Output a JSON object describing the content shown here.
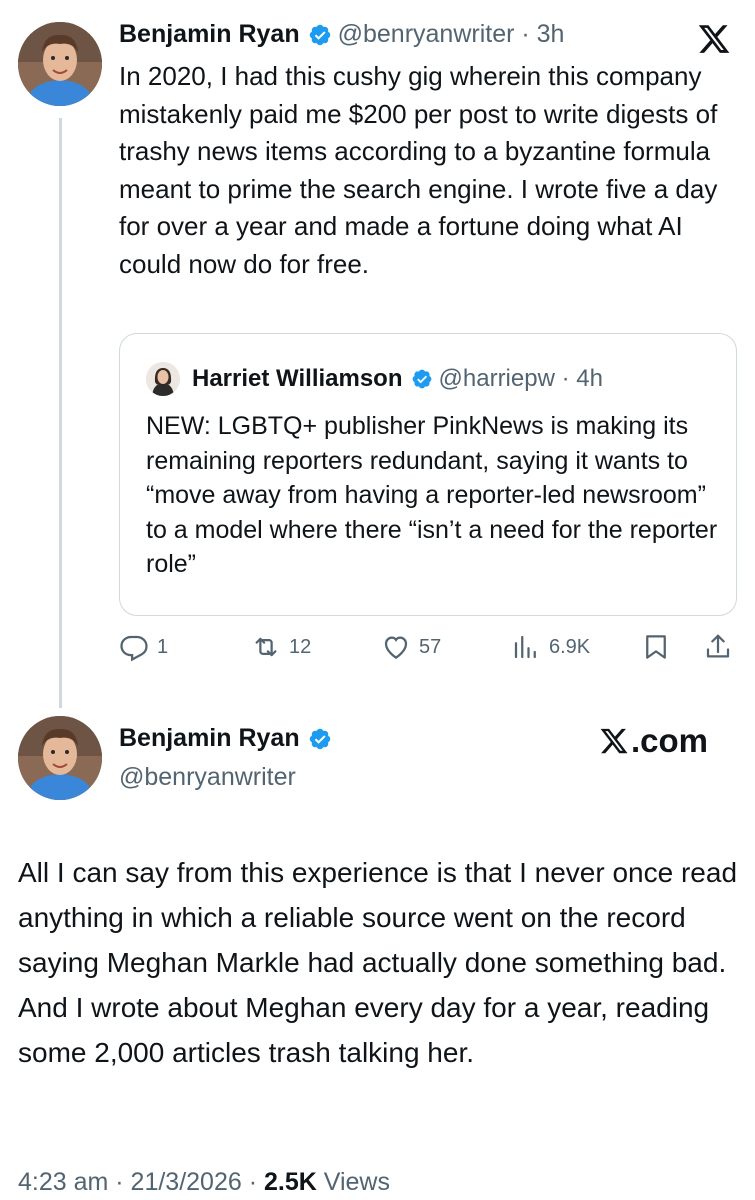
{
  "colors": {
    "text": "#0f1419",
    "muted": "#536471",
    "verified": "#1d9bf0",
    "border": "#cfd9de"
  },
  "tweet1": {
    "author_name": "Benjamin Ryan",
    "handle_time": "@benryanwriter · 3h",
    "text": "In 2020, I had this cushy gig wherein this company mistakenly paid me $200 per post to write digests of trashy news items according to a byzantine formula meant to prime the search engine. I wrote five a day for over a year and made a fortune doing what AI could now do for free.",
    "avatar_icon": "profile-photo",
    "quote": {
      "author_name": "Harriet Williamson",
      "handle_time": "@harriepw · 4h",
      "text": "NEW: LGBTQ+ publisher PinkNews is making its remaining reporters redundant, saying it wants to “move away from having a reporter-led newsroom” to a model where there “isn’t a need for the reporter role”"
    },
    "actions": {
      "replies": "1",
      "reposts": "12",
      "likes": "57",
      "views": "6.9K"
    }
  },
  "tweet2": {
    "author_name": "Benjamin Ryan",
    "handle": "@benryanwriter",
    "brand": ".com",
    "text": "All I can say from this experience is that I never once read anything in which a reliable source went on the record saying Meghan Markle had actually done something bad.  And I wrote about Meghan every day for a year, reading some 2,000 articles trash talking  her.",
    "meta_time_date": "4:23 am · 21/3/2026 · ",
    "meta_views_count": "2.5K",
    "meta_views_label": " Views"
  }
}
